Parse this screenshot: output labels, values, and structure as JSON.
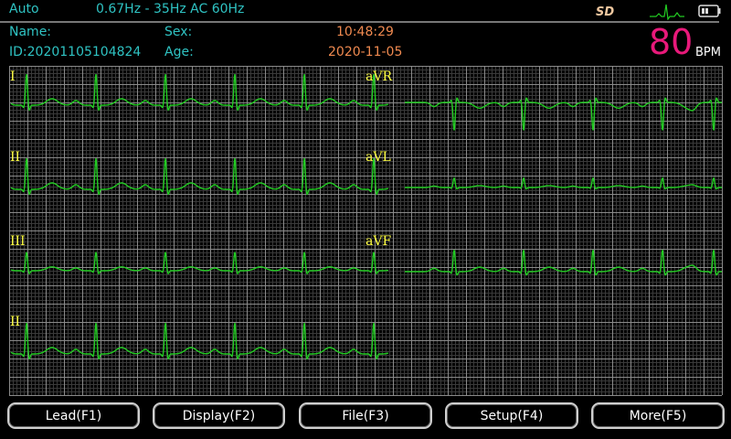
{
  "status_bar": {
    "mode": "Auto",
    "filter": "0.67Hz - 35Hz  AC 60Hz",
    "sd_label": "SD",
    "icons": [
      "sd-card-icon",
      "heartbeat-icon",
      "battery-icon"
    ]
  },
  "patient": {
    "name_label": "Name:",
    "id_label": "ID:20201105104824",
    "sex_label": "Sex:",
    "age_label": "Age:",
    "time": "10:48:29",
    "date": "2020-11-05"
  },
  "heart_rate": {
    "value": "80",
    "unit": "BPM",
    "color": "#e8197a"
  },
  "leads": [
    {
      "label": "I",
      "polarity": 1.0
    },
    {
      "label": "II",
      "polarity": 1.0
    },
    {
      "label": "III",
      "polarity": 0.6
    },
    {
      "label": "aVR",
      "polarity": -0.9
    },
    {
      "label": "aVL",
      "polarity": 0.3
    },
    {
      "label": "aVF",
      "polarity": 0.7
    },
    {
      "label": "II",
      "polarity": 1.0
    }
  ],
  "colors": {
    "trace": "#22cc22",
    "grid_major": "#8a8a8a",
    "grid_minor": "#3a3a3a",
    "lead_label": "#ffff40"
  },
  "buttons": [
    {
      "label": "Lead(F1)"
    },
    {
      "label": "Display(F2)"
    },
    {
      "label": "File(F3)"
    },
    {
      "label": "Setup(F4)"
    },
    {
      "label": "More(F5)"
    }
  ]
}
